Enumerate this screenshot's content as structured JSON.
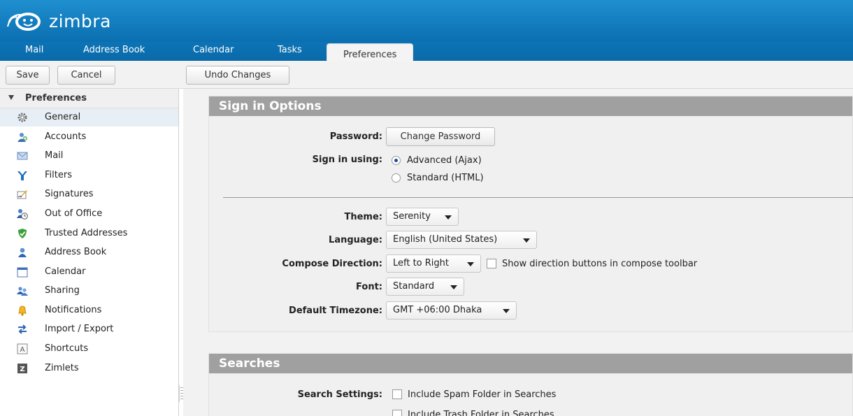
{
  "app": {
    "logo_text": "zimbra"
  },
  "tabs": [
    {
      "label": "Mail"
    },
    {
      "label": "Address Book"
    },
    {
      "label": "Calendar"
    },
    {
      "label": "Tasks"
    },
    {
      "label": "Preferences"
    }
  ],
  "toolbar": {
    "save_label": "Save",
    "cancel_label": "Cancel",
    "undo_label": "Undo Changes"
  },
  "sidebar": {
    "header": "Preferences",
    "items": [
      {
        "label": "General",
        "icon": "gear-icon"
      },
      {
        "label": "Accounts",
        "icon": "accounts-icon"
      },
      {
        "label": "Mail",
        "icon": "envelope-icon"
      },
      {
        "label": "Filters",
        "icon": "filter-icon"
      },
      {
        "label": "Signatures",
        "icon": "signature-icon"
      },
      {
        "label": "Out of Office",
        "icon": "out-of-office-icon"
      },
      {
        "label": "Trusted Addresses",
        "icon": "shield-check-icon"
      },
      {
        "label": "Address Book",
        "icon": "contact-icon"
      },
      {
        "label": "Calendar",
        "icon": "calendar-icon"
      },
      {
        "label": "Sharing",
        "icon": "sharing-icon"
      },
      {
        "label": "Notifications",
        "icon": "bell-icon"
      },
      {
        "label": "Import / Export",
        "icon": "import-export-icon"
      },
      {
        "label": "Shortcuts",
        "icon": "shortcut-key-icon"
      },
      {
        "label": "Zimlets",
        "icon": "zimlet-icon"
      }
    ]
  },
  "signin": {
    "title": "Sign in Options",
    "password_label": "Password:",
    "change_password": "Change Password",
    "sign_in_using_label": "Sign in using:",
    "option_advanced": "Advanced (Ajax)",
    "option_standard": "Standard (HTML)"
  },
  "display": {
    "theme_label": "Theme:",
    "theme_value": "Serenity",
    "language_label": "Language:",
    "language_value": "English (United States)",
    "compose_label": "Compose Direction:",
    "compose_value": "Left to Right",
    "show_direction_label": "Show direction buttons in compose toolbar",
    "font_label": "Font:",
    "font_value": "Standard",
    "timezone_label": "Default Timezone:",
    "timezone_value": "GMT +06:00 Dhaka"
  },
  "searches": {
    "title": "Searches",
    "settings_label": "Search Settings:",
    "include_spam": "Include Spam Folder in Searches",
    "include_trash": "Include Trash Folder in Searches"
  },
  "colors": {
    "header_blue": "#0a6fb0",
    "section_gray": "#a0a0a0"
  }
}
